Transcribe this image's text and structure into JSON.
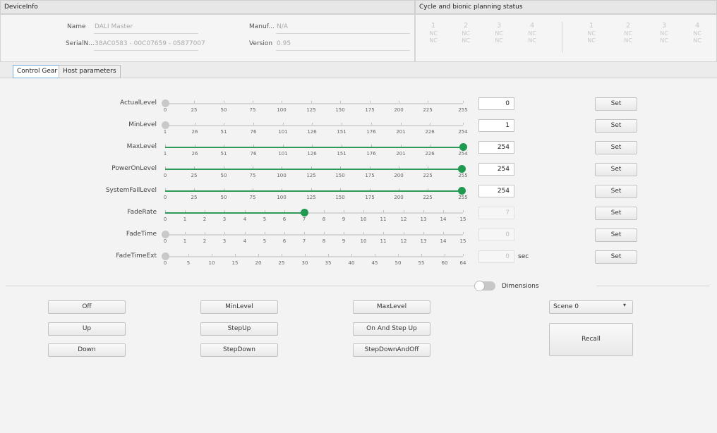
{
  "device_info": {
    "title": "DeviceInfo",
    "name_label": "Name",
    "name_value": "DALI Master",
    "manuf_label": "Manuf...",
    "manuf_value": "N/A",
    "serial_label": "SerialN...",
    "serial_value": "38AC0583 - 00C07659 - 05877007",
    "version_label": "Version",
    "version_value": "0.95"
  },
  "status_panel": {
    "title": "Cycle and bionic planning status",
    "group1": [
      {
        "num": "1",
        "a": "NC",
        "b": "NC"
      },
      {
        "num": "2",
        "a": "NC",
        "b": "NC"
      },
      {
        "num": "3",
        "a": "NC",
        "b": "NC"
      },
      {
        "num": "4",
        "a": "NC",
        "b": "NC"
      }
    ],
    "group2": [
      {
        "num": "1",
        "a": "NC",
        "b": "NC"
      },
      {
        "num": "2",
        "a": "NC",
        "b": "NC"
      },
      {
        "num": "3",
        "a": "NC",
        "b": "NC"
      },
      {
        "num": "4",
        "a": "NC",
        "b": "NC"
      }
    ]
  },
  "tabs": [
    {
      "label": "Control Gear",
      "active": true
    },
    {
      "label": "Host parameters",
      "active": false
    }
  ],
  "sliders": [
    {
      "label": "ActualLevel",
      "min": 0,
      "max": 255,
      "value": 0,
      "ticks": [
        "0",
        "25",
        "50",
        "75",
        "100",
        "125",
        "150",
        "175",
        "200",
        "225",
        "255"
      ],
      "field": "0",
      "enabled": true,
      "unit": ""
    },
    {
      "label": "MinLevel",
      "min": 1,
      "max": 254,
      "value": 1,
      "ticks": [
        "1",
        "26",
        "51",
        "76",
        "101",
        "126",
        "151",
        "176",
        "201",
        "226",
        "254"
      ],
      "field": "1",
      "enabled": true,
      "unit": ""
    },
    {
      "label": "MaxLevel",
      "min": 1,
      "max": 254,
      "value": 254,
      "ticks": [
        "1",
        "26",
        "51",
        "76",
        "101",
        "126",
        "151",
        "176",
        "201",
        "226",
        "254"
      ],
      "field": "254",
      "enabled": true,
      "unit": ""
    },
    {
      "label": "PowerOnLevel",
      "min": 0,
      "max": 255,
      "value": 254,
      "ticks": [
        "0",
        "25",
        "50",
        "75",
        "100",
        "125",
        "150",
        "175",
        "200",
        "225",
        "255"
      ],
      "field": "254",
      "enabled": true,
      "unit": ""
    },
    {
      "label": "SystemFailLevel",
      "min": 0,
      "max": 255,
      "value": 254,
      "ticks": [
        "0",
        "25",
        "50",
        "75",
        "100",
        "125",
        "150",
        "175",
        "200",
        "225",
        "255"
      ],
      "field": "254",
      "enabled": true,
      "unit": ""
    },
    {
      "label": "FadeRate",
      "min": 0,
      "max": 15,
      "value": 7,
      "ticks": [
        "0",
        "1",
        "2",
        "3",
        "4",
        "5",
        "6",
        "7",
        "8",
        "9",
        "10",
        "11",
        "12",
        "13",
        "14",
        "15"
      ],
      "field": "7",
      "enabled": false,
      "unit": ""
    },
    {
      "label": "FadeTime",
      "min": 0,
      "max": 15,
      "value": 0,
      "ticks": [
        "0",
        "1",
        "2",
        "3",
        "4",
        "5",
        "6",
        "7",
        "8",
        "9",
        "10",
        "11",
        "12",
        "13",
        "14",
        "15"
      ],
      "field": "0",
      "enabled": false,
      "unit": ""
    },
    {
      "label": "FadeTimeExt",
      "min": 0,
      "max": 64,
      "value": 0,
      "ticks": [
        "0",
        "5",
        "10",
        "15",
        "20",
        "25",
        "30",
        "35",
        "40",
        "45",
        "50",
        "55",
        "60",
        "64"
      ],
      "field": "0",
      "enabled": false,
      "unit": "sec"
    }
  ],
  "set_label": "Set",
  "dimensions_label": "Dimensions",
  "dimensions_on": false,
  "buttons": {
    "off": "Off",
    "up": "Up",
    "down": "Down",
    "minlevel": "MinLevel",
    "stepup": "StepUp",
    "stepdown": "StepDown",
    "maxlevel": "MaxLevel",
    "on_and_step_up": "On And Step Up",
    "stepdownandoff": "StepDownAndOff"
  },
  "scene_select": {
    "value": "Scene 0"
  },
  "recall_label": "Recall",
  "colors": {
    "accent": "#1f9a50",
    "tab_active_border": "#78aee0"
  }
}
